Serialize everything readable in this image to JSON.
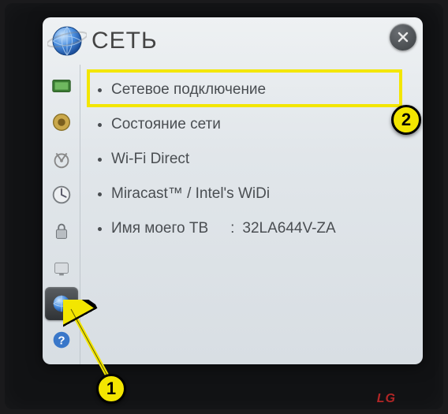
{
  "header": {
    "title": "СЕТЬ"
  },
  "sidebar": {
    "items": [
      {
        "icon": "picture-icon"
      },
      {
        "icon": "sound-icon"
      },
      {
        "icon": "channel-icon"
      },
      {
        "icon": "time-icon"
      },
      {
        "icon": "lock-icon"
      },
      {
        "icon": "option-icon"
      },
      {
        "icon": "network-icon",
        "active": true
      },
      {
        "icon": "support-icon"
      }
    ]
  },
  "menu": {
    "items": [
      {
        "label": "Сетевое подключение"
      },
      {
        "label": "Состояние сети"
      },
      {
        "label": "Wi-Fi Direct"
      },
      {
        "label": "Miracast™ / Intel's WiDi"
      },
      {
        "label": "Имя моего ТВ",
        "value": "32LA644V-ZA"
      }
    ]
  },
  "annotations": {
    "callout1": "1",
    "callout2": "2"
  },
  "brand": "LG"
}
